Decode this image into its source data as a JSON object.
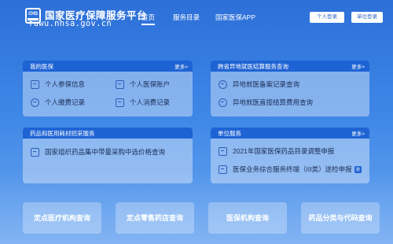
{
  "header": {
    "logo_text": "CHS",
    "title": "国家医疗保障服务平台",
    "url": "fuwu.nhsa.gov.cn",
    "nav": [
      "首页",
      "服务目录",
      "国家医保APP"
    ],
    "buttons": [
      "个人登录",
      "单位登录"
    ]
  },
  "my_insurance": {
    "title": "我的医保",
    "more": "更多>",
    "items": [
      "个人参保信息",
      "个人医保账户",
      "个人缴费记录",
      "个人消费记录"
    ]
  },
  "cross_region": {
    "title": "跨省异地就医结算服务查询",
    "more": "更多>",
    "items": [
      "异地就医备案记录查询",
      "异地就医直接结算费用查询"
    ]
  },
  "drug_procurement": {
    "title": "药品和医用耗材招采服务",
    "items": [
      "国家组织药品集中带量采购中选价格查询"
    ]
  },
  "unit_service": {
    "title": "单位服务",
    "more": "更多>",
    "items": [
      "2021年国家医保药品目录调整申报",
      "医保业务综合服务终端（III类）送检申报"
    ],
    "badge": "测"
  },
  "quick_links": [
    "定点医疗机构查询",
    "定点零售药店查询",
    "医保机构查询",
    "药品分类与代码查询"
  ]
}
